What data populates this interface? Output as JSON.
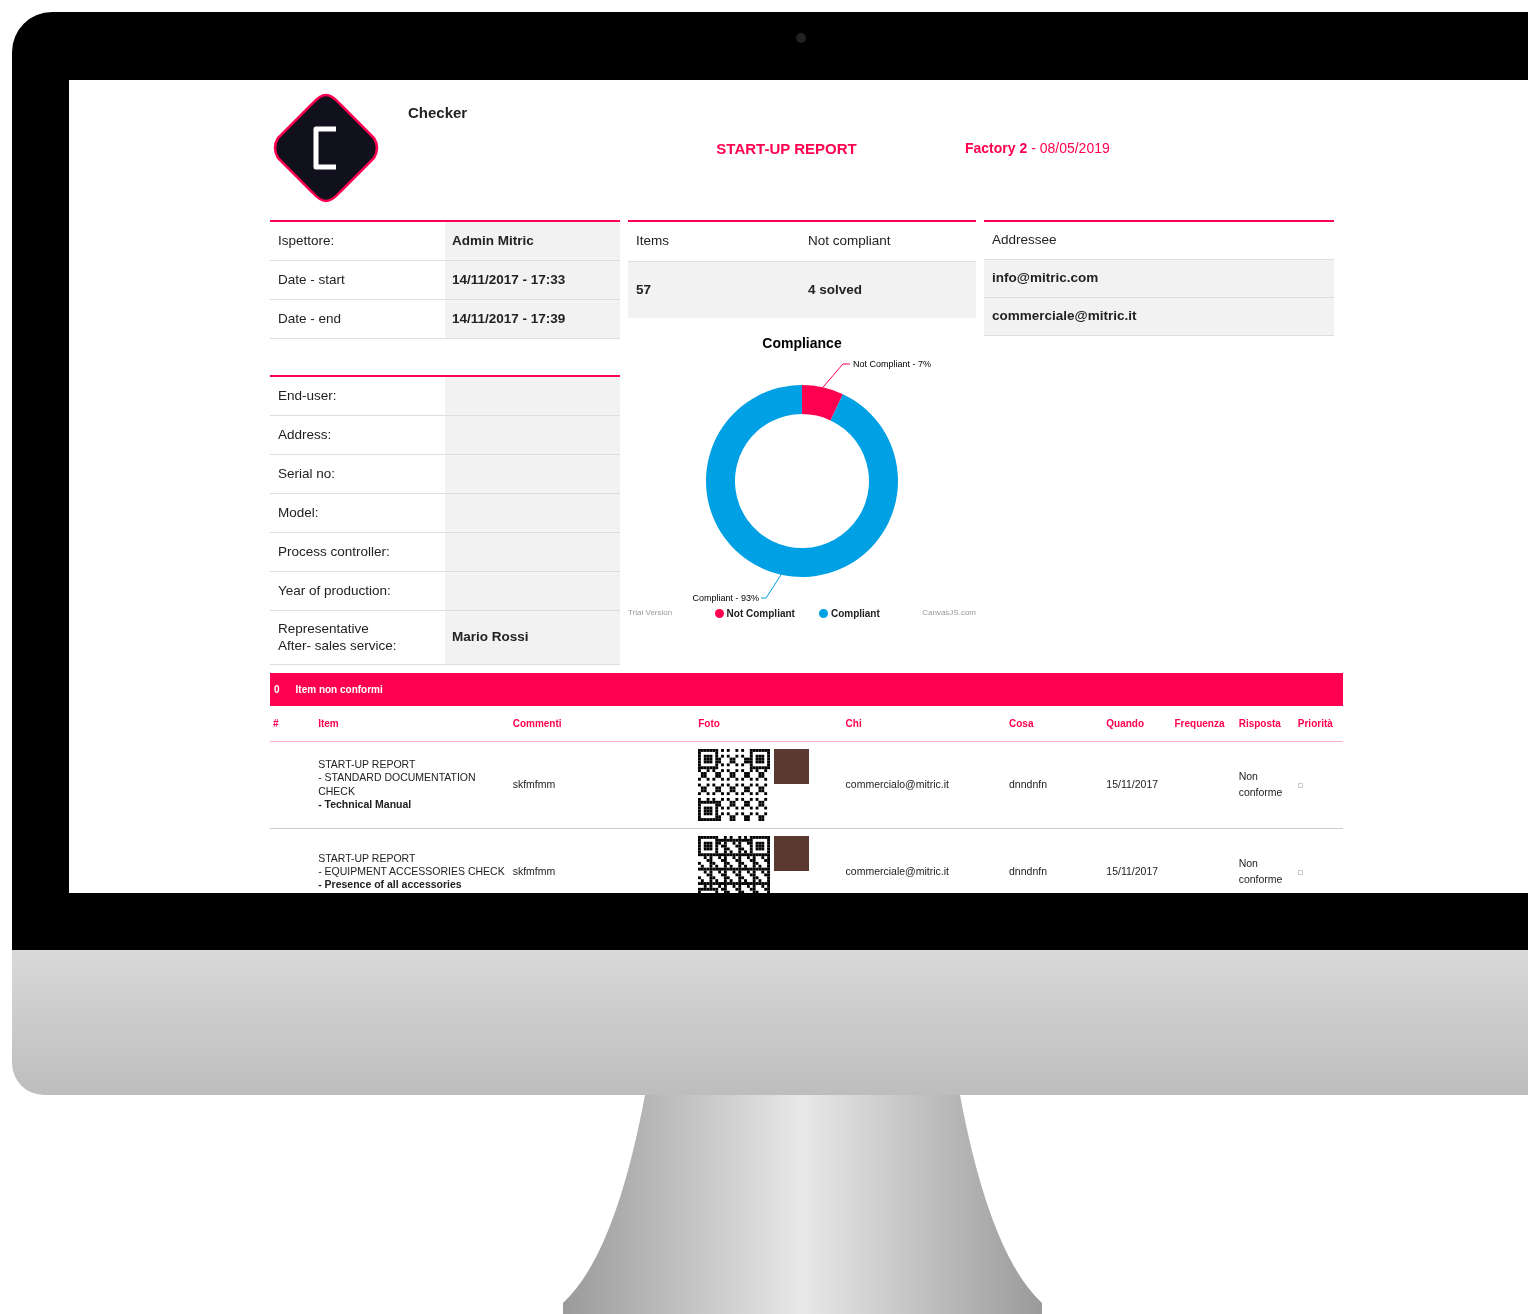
{
  "app": {
    "name": "Checker"
  },
  "header": {
    "title": "START-UP REPORT",
    "site_date": "**Factory 2** - 08/05/2019"
  },
  "inspection": [
    {
      "label": "Ispettore:",
      "value": "Admin Mitric"
    },
    {
      "label": "Date - start",
      "value": "14/11/2017 - 17:33"
    },
    {
      "label": "Date - end",
      "value": "14/11/2017 - 17:39"
    }
  ],
  "summary": {
    "columns": [
      "Items",
      "Not compliant"
    ],
    "values": [
      "57",
      "4 solved"
    ]
  },
  "addressee": {
    "heading": "Addressee",
    "emails": [
      "info@mitric.com",
      "commerciale@mitric.it"
    ]
  },
  "equipment": [
    {
      "label": "End-user:"
    },
    {
      "label": "Address:"
    },
    {
      "label": "Serial no:"
    },
    {
      "label": "Model:"
    },
    {
      "label": "Process controller:"
    },
    {
      "label": "Year of production:"
    },
    {
      "label": "Representative\nAfter- sales service:",
      "value": "Mario Rossi"
    }
  ],
  "compliance": {
    "chart_data": {
      "type": "donut",
      "title": "Compliance",
      "categories": [
        "Not Compliant",
        "Compliant"
      ],
      "colors": [
        "#ff0050",
        "#00a0e4"
      ],
      "series": [
        {
          "values": [
            7,
            93
          ]
        }
      ],
      "value_labels": [
        "Not Compliant - 7%",
        "Compliant - 93%"
      ],
      "legend": "bottom"
    },
    "footer_left": "Trial Version",
    "footer_right": "CanvasJS.com"
  },
  "nonconformities": {
    "count": "0",
    "title": "Item non conformi",
    "columns": [
      "#",
      "Item",
      "Commenti",
      "Foto",
      "Chi",
      "Cosa",
      "Quando",
      "Frequenza",
      "Risposta",
      "Priorità"
    ],
    "rows": [
      {
        "item": "START-UP REPORT\n- STANDARD DOCUMENTATION CHECK\n**- Technical Manual**",
        "comment": "skfmfmm",
        "who": "commercialo@mitric.it",
        "what": "dnndnfn",
        "when": "15/11/2017",
        "answer": "Non conforme"
      },
      {
        "item": "START-UP REPORT\n- EQUIPMENT ACCESSORIES CHECK\n**- Presence of all accessories**",
        "comment": "skfmfmm",
        "who": "commerciale@mitric.it",
        "what": "dnndnfn",
        "when": "15/11/2017",
        "answer": "Non conforme"
      }
    ]
  }
}
